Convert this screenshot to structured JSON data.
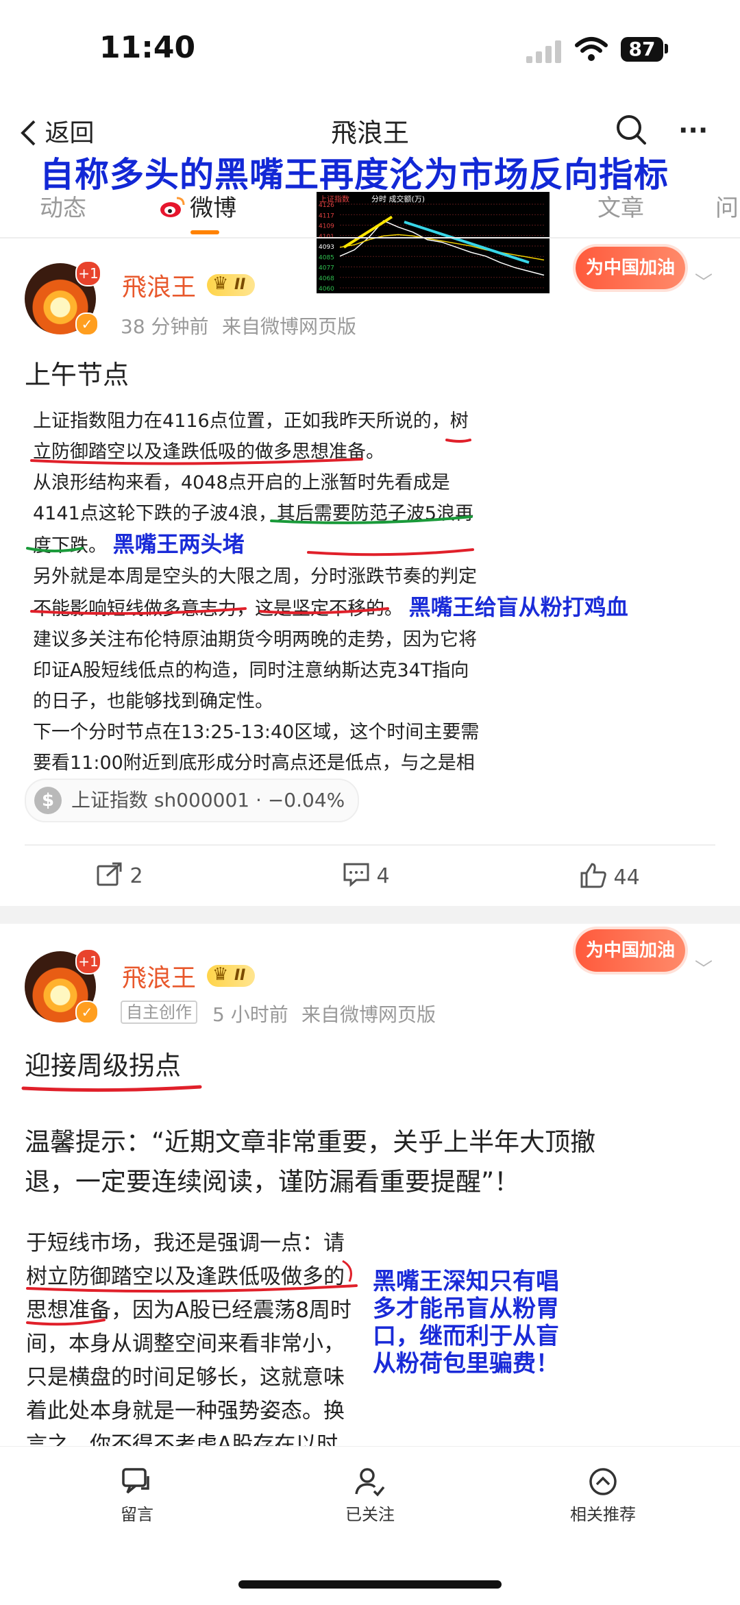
{
  "status_bar": {
    "time": "11:40",
    "battery": "87"
  },
  "nav": {
    "back_label": "返回",
    "title": "飛浪王"
  },
  "overlay_headline": "自称多头的黑嘴王再度沦为市场反向指标",
  "tabs": [
    {
      "label": "动态"
    },
    {
      "label": "微博"
    },
    {
      "label": "文章"
    },
    {
      "label": "问"
    }
  ],
  "chart_data": {
    "type": "line",
    "title": "上证指数",
    "header_extra": "分时  成交额(万)",
    "ytick_labels": [
      "4126",
      "4117",
      "4109",
      "4101",
      "4093",
      "4085",
      "4077",
      "4068",
      "4060"
    ],
    "ylim": [
      4060,
      4126
    ],
    "series": [
      {
        "values": [
          4085,
          4090,
          4100,
          4113,
          4108,
          4104,
          4098,
          4096,
          4092,
          4088,
          4085,
          4080,
          4076,
          4073,
          4070
        ]
      },
      {
        "values": [
          4092,
          4094,
          4098,
          4101,
          4102,
          4101,
          4099,
          4097,
          4095,
          4093,
          4090,
          4088,
          4086,
          4084,
          4082
        ]
      }
    ],
    "annotations": [
      "yellow up-trend line",
      "cyan down-trend line"
    ]
  },
  "post1": {
    "author": "飛浪王",
    "level": "II",
    "time": "38 分钟前",
    "source": "来自微博网页版",
    "stamp": "为中国加油",
    "avatar_badge": "+1",
    "title": "上午节点",
    "lines": [
      "上证指数阻力在4116点位置，正如我昨天所说的，树",
      "立防御踏空以及逢跌低吸的做多思想准备。",
      "从浪形结构来看，4048点开启的上涨暂时先看成是",
      "4141点这轮下跌的子波4浪，其后需要防范子波5浪再",
      "度下跌。",
      "另外就是本周是空头的大限之周，分时涨跌节奏的判定",
      "不能影响短线做多意志力，这是坚定不移的。",
      "建议多关注布伦特原油期货今明两晚的走势，因为它将",
      "印证A股短线低点的构造，同时注意纳斯达克34T指向",
      "的日子，也能够找到确定性。",
      "下一个分时节点在13:25-13:40区域，这个时间主要需",
      "要看11:00附近到底形成分时高点还是低点，与之是相"
    ],
    "annotation_1": "黑嘴王两头堵",
    "annotation_2": "黑嘴王给盲从粉打鸡血",
    "stock_chip": "上证指数 sh000001 · −0.04%",
    "reposts": "2",
    "comments": "4",
    "likes": "44"
  },
  "post2": {
    "author": "飛浪王",
    "level": "II",
    "tag": "自主创作",
    "time": "5 小时前",
    "source": "来自微博网页版",
    "stamp": "为中国加油",
    "avatar_badge": "+1",
    "title": "迎接周级拐点",
    "notice_lines": [
      "温馨提示：“近期文章非常重要，关乎上半年大顶撤",
      "退，一定要连续阅读，谨防漏看重要提醒”！"
    ],
    "body_lines": [
      "于短线市场，我还是强调一点：请",
      "树立防御踏空以及逢跌低吸做多的",
      "思想准备，因为A股已经震荡8周时",
      "间，本身从调整空间来看非常小，",
      "只是横盘的时间足够长，这就意味",
      "着此处本身就是一种强势姿态。换",
      "言之，你不得不考虑A股存在以时"
    ],
    "annotation_lines": [
      "黑嘴王深知只有唱",
      "多才能吊盲从粉胃",
      "口，继而利于从盲",
      "从粉荷包里骗费！"
    ]
  },
  "bottom_nav": [
    {
      "label": "留言",
      "icon": "comment-icon"
    },
    {
      "label": "已关注",
      "icon": "followed-icon"
    },
    {
      "label": "相关推荐",
      "icon": "recommend-icon"
    }
  ]
}
